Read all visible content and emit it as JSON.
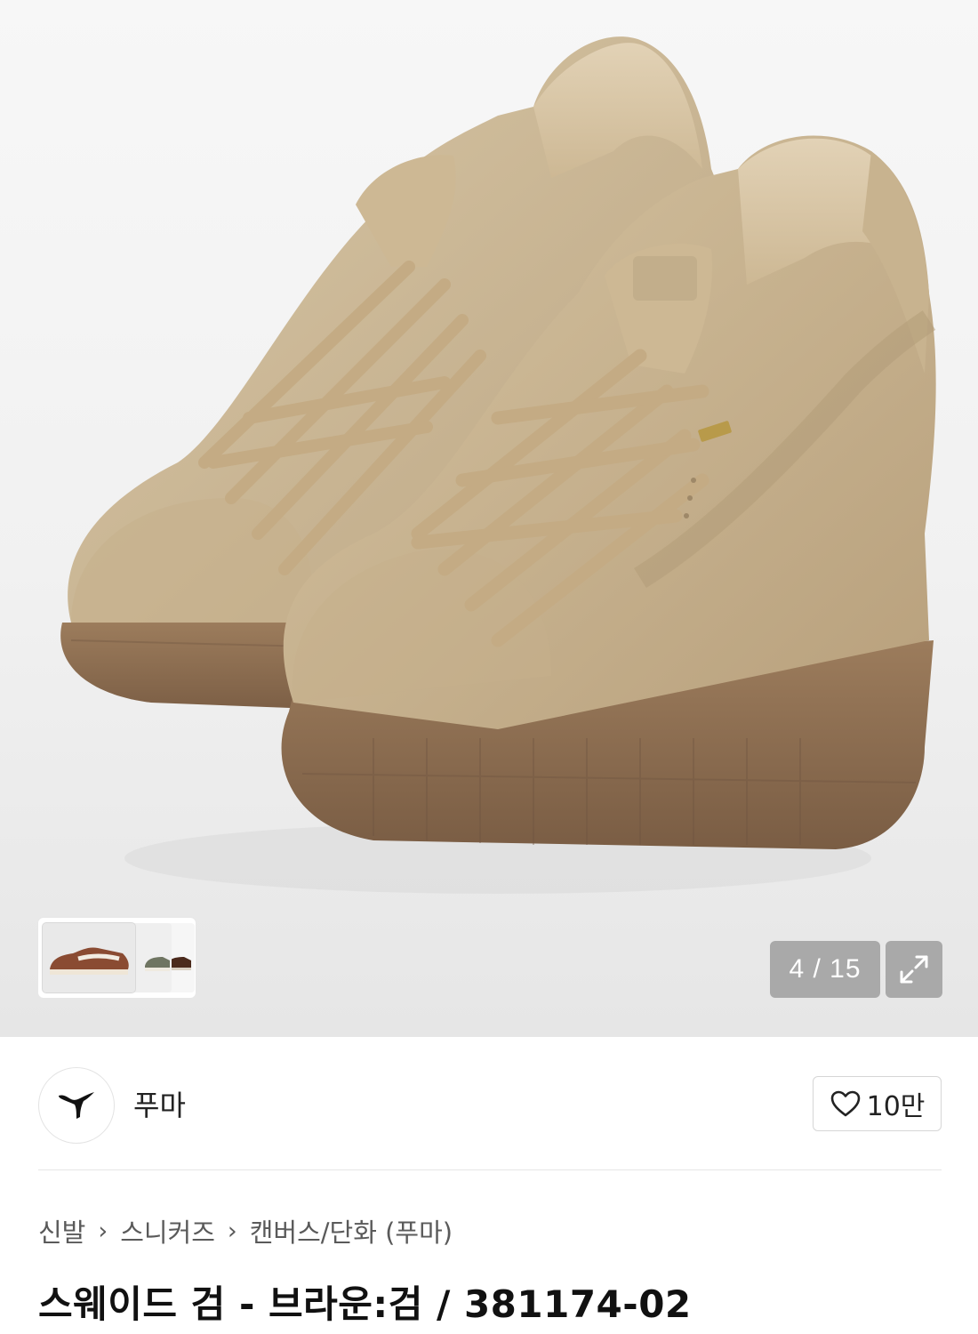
{
  "gallery": {
    "counter": "4 / 15",
    "thumbnails": [
      {
        "name": "brown-suede-thumb"
      },
      {
        "name": "green-suede-thumb"
      },
      {
        "name": "dark-brown-suede-thumb"
      }
    ],
    "next_icon": "chevron-right-icon",
    "expand_icon": "expand-icon"
  },
  "brand": {
    "name": "푸마",
    "logo_icon": "puma-logo-icon",
    "like_icon": "heart-outline-icon",
    "like_count": "10만"
  },
  "breadcrumb": {
    "items": [
      "신발",
      "스니커즈",
      "캔버스/단화 (푸마)"
    ],
    "separator": "›"
  },
  "product": {
    "title": "스웨이드 검 - 브라운:검 / 381174-02"
  },
  "colors": {
    "accent_gray": "#a9a9a9",
    "suede": "#c9b592",
    "gum_sole": "#8b6c50"
  }
}
